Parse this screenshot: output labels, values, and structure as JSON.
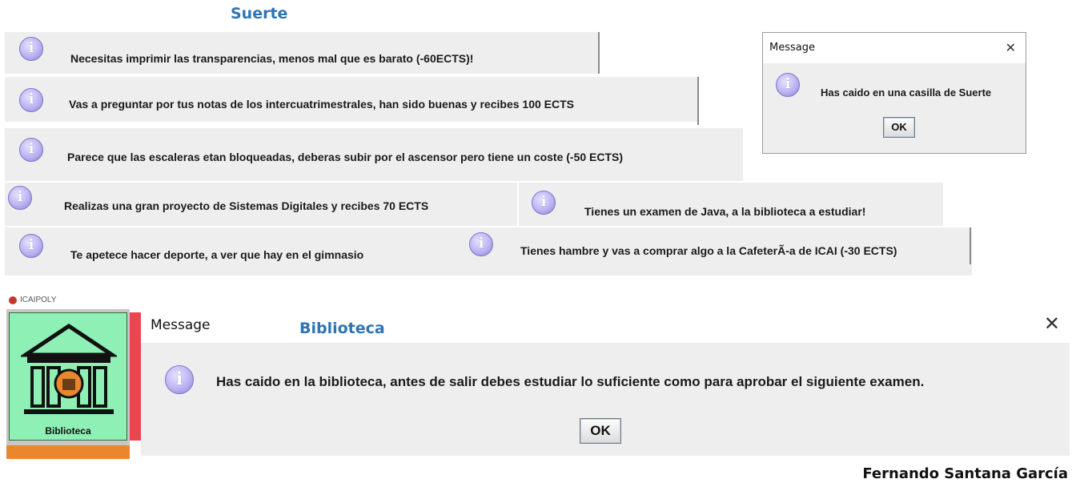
{
  "headings": {
    "suerte": "Suerte",
    "biblioteca": "Biblioteca"
  },
  "messages": [
    "Necesitas imprimir las transparencias, menos mal que es barato (-60ECTS)!",
    "Vas a preguntar por tus notas de los intercuatrimestrales, han sido buenas y recibes 100 ECTS",
    "Parece que las escaleras etan bloqueadas, deberas subir por el ascensor pero tiene un coste (-50 ECTS)",
    "Realizas una gran proyecto de Sistemas Digitales y recibes 70 ECTS",
    "Tienes un examen de Java, a la biblioteca a estudiar!",
    "Te apetece hacer deporte, a ver que hay en el gimnasio",
    "Tienes hambre y vas a comprar algo a la CafeterÃ-a de ICAI (-30 ECTS)"
  ],
  "small_dialog": {
    "title": "Message",
    "close": "✕",
    "text": "Has caido en una casilla de Suerte",
    "ok": "OK"
  },
  "big_dialog": {
    "title": "Message",
    "close": "✕",
    "text": "Has caido en la biblioteca, antes de salir debes estudiar lo suficiente como para aprobar el siguiente examen.",
    "ok": "OK"
  },
  "board": {
    "app_name": "ICAIPOLY",
    "tile_label": "Biblioteca"
  },
  "author": "Fernando Santana García",
  "icons": {
    "info": "info-icon",
    "close": "close-icon",
    "library": "library-icon"
  },
  "colors": {
    "heading": "#2e74b5",
    "tile_green": "#8ef0b4",
    "tile_red": "#e8474f",
    "tile_orange": "#e9862e",
    "info_purple": "#bcb3f2"
  }
}
